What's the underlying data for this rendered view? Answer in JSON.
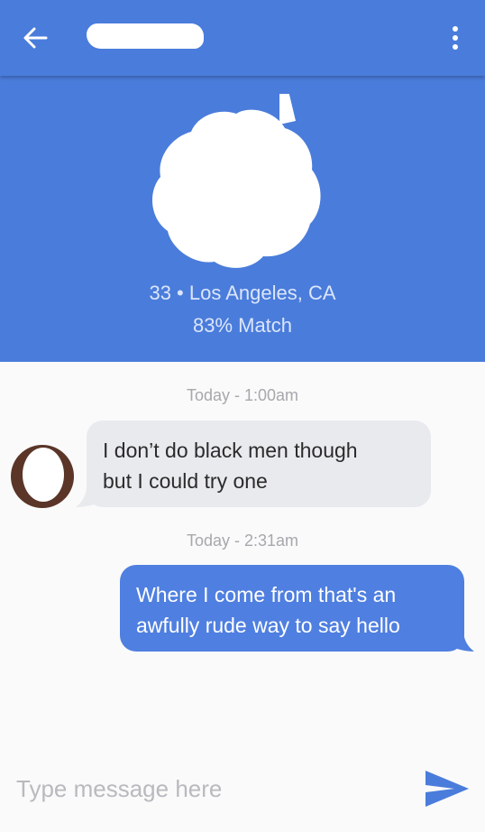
{
  "header": {
    "back_icon": "arrow-left-icon",
    "menu_icon": "more-vertical-icon",
    "color": "#4a7cdb"
  },
  "profile": {
    "age_location": "33 • Los Angeles, CA",
    "match": "83% Match"
  },
  "conversation": [
    {
      "timestamp": "Today - 1:00am",
      "direction": "incoming",
      "text_line1": "I don’t do black men though",
      "text_line2": "but I could try one"
    },
    {
      "timestamp": "Today - 2:31am",
      "direction": "outgoing",
      "text_line1": "Where I come from that's an",
      "text_line2": "awfully rude way to say hello"
    }
  ],
  "composer": {
    "placeholder": "Type message here",
    "send_icon": "send-icon"
  }
}
